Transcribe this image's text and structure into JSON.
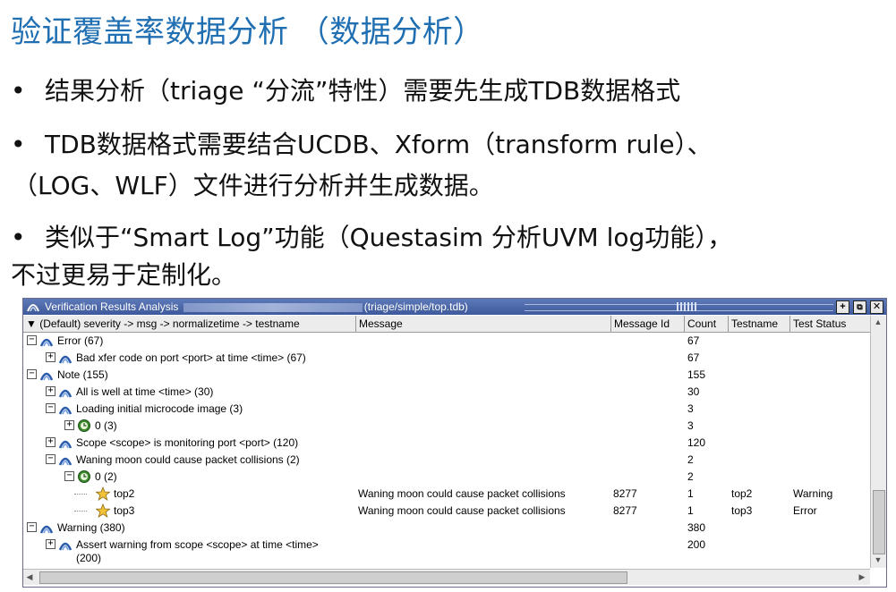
{
  "slide": {
    "title": "验证覆盖率数据分析 （数据分析）",
    "bullet_symbol": "•",
    "bullets": [
      {
        "lines": [
          "结果分析（triage “分流”特性）需要先生成TDB数据格式"
        ]
      },
      {
        "lines": [
          "TDB数据格式需要结合UCDB、Xform（transform rule）、",
          "（LOG、WLF）文件进行分析并生成数据。"
        ]
      },
      {
        "lines": [
          "类似于“Smart Log”功能（Questasim 分析UVM log功能），",
          "不过更易于定制化。"
        ]
      }
    ]
  },
  "window": {
    "title": "Verification Results Analysis",
    "title_path": "(triage/simple/top.tdb)",
    "buttons": {
      "add": "+",
      "float": "⧉",
      "close": "✕"
    },
    "columns": {
      "tree": "▼ (Default) severity -> msg -> normalizetime -> testname",
      "message": "Message",
      "message_id": "Message Id",
      "count": "Count",
      "testname": "Testname",
      "status": "Test Status"
    },
    "rows": [
      {
        "depth": 0,
        "expander": "−",
        "icon": "group-icon",
        "label": "Error (67)",
        "message": "",
        "message_id": "",
        "count": "67",
        "testname": "",
        "status": ""
      },
      {
        "depth": 1,
        "expander": "+",
        "icon": "group-icon",
        "label": "Bad xfer code on port <port> at time <time> (67)",
        "message": "",
        "message_id": "",
        "count": "67",
        "testname": "",
        "status": ""
      },
      {
        "depth": 0,
        "expander": "−",
        "icon": "group-icon",
        "label": "Note (155)",
        "message": "",
        "message_id": "",
        "count": "155",
        "testname": "",
        "status": ""
      },
      {
        "depth": 1,
        "expander": "+",
        "icon": "group-icon",
        "label": "All is well at time <time> (30)",
        "message": "",
        "message_id": "",
        "count": "30",
        "testname": "",
        "status": ""
      },
      {
        "depth": 1,
        "expander": "−",
        "icon": "group-icon",
        "label": "Loading initial microcode image (3)",
        "message": "",
        "message_id": "",
        "count": "3",
        "testname": "",
        "status": ""
      },
      {
        "depth": 2,
        "expander": "+",
        "icon": "clock-icon",
        "label": "0 (3)",
        "message": "",
        "message_id": "",
        "count": "3",
        "testname": "",
        "status": ""
      },
      {
        "depth": 1,
        "expander": "+",
        "icon": "group-icon",
        "label": "Scope <scope> is monitoring port <port> (120)",
        "message": "",
        "message_id": "",
        "count": "120",
        "testname": "",
        "status": ""
      },
      {
        "depth": 1,
        "expander": "−",
        "icon": "group-icon",
        "label": "Waning moon could cause packet collisions (2)",
        "message": "",
        "message_id": "",
        "count": "2",
        "testname": "",
        "status": ""
      },
      {
        "depth": 2,
        "expander": "−",
        "icon": "clock-icon",
        "label": "0 (2)",
        "message": "",
        "message_id": "",
        "count": "2",
        "testname": "",
        "status": ""
      },
      {
        "depth": 3,
        "expander": "",
        "icon": "star-icon",
        "label": "top2",
        "message": "Waning moon could cause packet collisions",
        "message_id": "8277",
        "count": "1",
        "testname": "top2",
        "status": "Warning"
      },
      {
        "depth": 3,
        "expander": "",
        "icon": "star-icon",
        "label": "top3",
        "message": "Waning moon could cause packet collisions",
        "message_id": "8277",
        "count": "1",
        "testname": "top3",
        "status": "Error"
      },
      {
        "depth": 0,
        "expander": "−",
        "icon": "group-icon",
        "label": "Warning (380)",
        "message": "",
        "message_id": "",
        "count": "380",
        "testname": "",
        "status": ""
      },
      {
        "depth": 1,
        "expander": "+",
        "icon": "group-icon",
        "label": "Assert warning from scope <scope> at time <time>",
        "label2": "(200)",
        "message": "",
        "message_id": "",
        "count": "200",
        "testname": "",
        "status": ""
      }
    ]
  },
  "colors": {
    "title": "#1f6fb2",
    "titlebar": "#4a66a8"
  }
}
